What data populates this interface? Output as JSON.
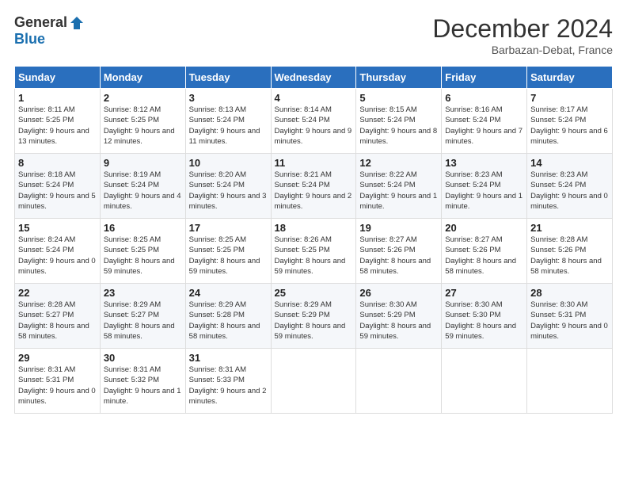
{
  "logo": {
    "general": "General",
    "blue": "Blue"
  },
  "header": {
    "title": "December 2024",
    "subtitle": "Barbazan-Debat, France"
  },
  "weekdays": [
    "Sunday",
    "Monday",
    "Tuesday",
    "Wednesday",
    "Thursday",
    "Friday",
    "Saturday"
  ],
  "weeks": [
    [
      {
        "day": "1",
        "info": "Sunrise: 8:11 AM\nSunset: 5:25 PM\nDaylight: 9 hours and 13 minutes."
      },
      {
        "day": "2",
        "info": "Sunrise: 8:12 AM\nSunset: 5:25 PM\nDaylight: 9 hours and 12 minutes."
      },
      {
        "day": "3",
        "info": "Sunrise: 8:13 AM\nSunset: 5:24 PM\nDaylight: 9 hours and 11 minutes."
      },
      {
        "day": "4",
        "info": "Sunrise: 8:14 AM\nSunset: 5:24 PM\nDaylight: 9 hours and 9 minutes."
      },
      {
        "day": "5",
        "info": "Sunrise: 8:15 AM\nSunset: 5:24 PM\nDaylight: 9 hours and 8 minutes."
      },
      {
        "day": "6",
        "info": "Sunrise: 8:16 AM\nSunset: 5:24 PM\nDaylight: 9 hours and 7 minutes."
      },
      {
        "day": "7",
        "info": "Sunrise: 8:17 AM\nSunset: 5:24 PM\nDaylight: 9 hours and 6 minutes."
      }
    ],
    [
      {
        "day": "8",
        "info": "Sunrise: 8:18 AM\nSunset: 5:24 PM\nDaylight: 9 hours and 5 minutes."
      },
      {
        "day": "9",
        "info": "Sunrise: 8:19 AM\nSunset: 5:24 PM\nDaylight: 9 hours and 4 minutes."
      },
      {
        "day": "10",
        "info": "Sunrise: 8:20 AM\nSunset: 5:24 PM\nDaylight: 9 hours and 3 minutes."
      },
      {
        "day": "11",
        "info": "Sunrise: 8:21 AM\nSunset: 5:24 PM\nDaylight: 9 hours and 2 minutes."
      },
      {
        "day": "12",
        "info": "Sunrise: 8:22 AM\nSunset: 5:24 PM\nDaylight: 9 hours and 1 minute."
      },
      {
        "day": "13",
        "info": "Sunrise: 8:23 AM\nSunset: 5:24 PM\nDaylight: 9 hours and 1 minute."
      },
      {
        "day": "14",
        "info": "Sunrise: 8:23 AM\nSunset: 5:24 PM\nDaylight: 9 hours and 0 minutes."
      }
    ],
    [
      {
        "day": "15",
        "info": "Sunrise: 8:24 AM\nSunset: 5:24 PM\nDaylight: 9 hours and 0 minutes."
      },
      {
        "day": "16",
        "info": "Sunrise: 8:25 AM\nSunset: 5:25 PM\nDaylight: 8 hours and 59 minutes."
      },
      {
        "day": "17",
        "info": "Sunrise: 8:25 AM\nSunset: 5:25 PM\nDaylight: 8 hours and 59 minutes."
      },
      {
        "day": "18",
        "info": "Sunrise: 8:26 AM\nSunset: 5:25 PM\nDaylight: 8 hours and 59 minutes."
      },
      {
        "day": "19",
        "info": "Sunrise: 8:27 AM\nSunset: 5:26 PM\nDaylight: 8 hours and 58 minutes."
      },
      {
        "day": "20",
        "info": "Sunrise: 8:27 AM\nSunset: 5:26 PM\nDaylight: 8 hours and 58 minutes."
      },
      {
        "day": "21",
        "info": "Sunrise: 8:28 AM\nSunset: 5:26 PM\nDaylight: 8 hours and 58 minutes."
      }
    ],
    [
      {
        "day": "22",
        "info": "Sunrise: 8:28 AM\nSunset: 5:27 PM\nDaylight: 8 hours and 58 minutes."
      },
      {
        "day": "23",
        "info": "Sunrise: 8:29 AM\nSunset: 5:27 PM\nDaylight: 8 hours and 58 minutes."
      },
      {
        "day": "24",
        "info": "Sunrise: 8:29 AM\nSunset: 5:28 PM\nDaylight: 8 hours and 58 minutes."
      },
      {
        "day": "25",
        "info": "Sunrise: 8:29 AM\nSunset: 5:29 PM\nDaylight: 8 hours and 59 minutes."
      },
      {
        "day": "26",
        "info": "Sunrise: 8:30 AM\nSunset: 5:29 PM\nDaylight: 8 hours and 59 minutes."
      },
      {
        "day": "27",
        "info": "Sunrise: 8:30 AM\nSunset: 5:30 PM\nDaylight: 8 hours and 59 minutes."
      },
      {
        "day": "28",
        "info": "Sunrise: 8:30 AM\nSunset: 5:31 PM\nDaylight: 9 hours and 0 minutes."
      }
    ],
    [
      {
        "day": "29",
        "info": "Sunrise: 8:31 AM\nSunset: 5:31 PM\nDaylight: 9 hours and 0 minutes."
      },
      {
        "day": "30",
        "info": "Sunrise: 8:31 AM\nSunset: 5:32 PM\nDaylight: 9 hours and 1 minute."
      },
      {
        "day": "31",
        "info": "Sunrise: 8:31 AM\nSunset: 5:33 PM\nDaylight: 9 hours and 2 minutes."
      },
      null,
      null,
      null,
      null
    ]
  ]
}
